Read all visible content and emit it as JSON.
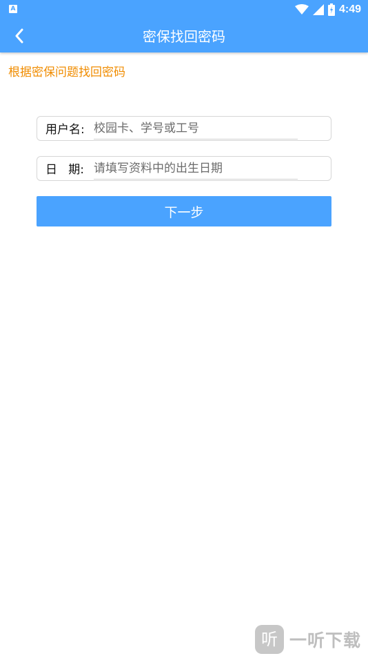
{
  "status_bar": {
    "app_icon_letter": "A",
    "time": "4:49",
    "icons": [
      "wifi-icon",
      "signal-icon",
      "battery-icon"
    ]
  },
  "appbar": {
    "back_icon": "chevron-left-icon",
    "title": "密保找回密码"
  },
  "hint": "根据密保问题找回密码",
  "form": {
    "username": {
      "label": "用户名:",
      "placeholder": "校园卡、学号或工号",
      "value": ""
    },
    "date": {
      "label": "日   期:",
      "placeholder": "请填写资料中的出生日期",
      "value": ""
    },
    "next_button": "下一步"
  },
  "watermark": {
    "logo_char": "听",
    "text": "一听下载"
  },
  "colors": {
    "primary": "#4aa3ff",
    "hint": "#f08c00"
  }
}
